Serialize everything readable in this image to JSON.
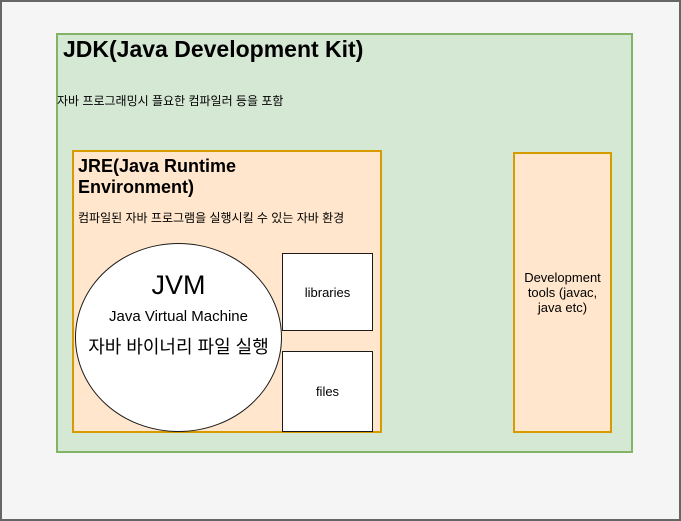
{
  "diagram": {
    "jdk": {
      "title": "JDK(Java Development Kit)",
      "subtitle": "자바 프로그래밍시 플요한 컴파일러 등을 포함"
    },
    "jre": {
      "title": "JRE(Java Runtime Environment)",
      "subtitle": "컴파일된 자바 프로그램을 실행시킬 수 있는 자바 환경"
    },
    "jvm": {
      "title": "JVM",
      "subtitle": "Java Virtual Machine",
      "description": "자바 바이너리 파일 실행"
    },
    "libraries_label": "libraries",
    "files_label": "files",
    "dev_tools_label": "Development tools (javac, java etc)"
  },
  "colors": {
    "canvas_bg": "#f5f5f5",
    "canvas_border": "#666666",
    "jdk_fill": "#d5e8d4",
    "jdk_border": "#82b366",
    "jre_fill": "#ffe6cc",
    "jre_border": "#d79b00",
    "shape_fill": "#ffffff",
    "shape_border": "#1a1a1a",
    "text": "#000000"
  }
}
